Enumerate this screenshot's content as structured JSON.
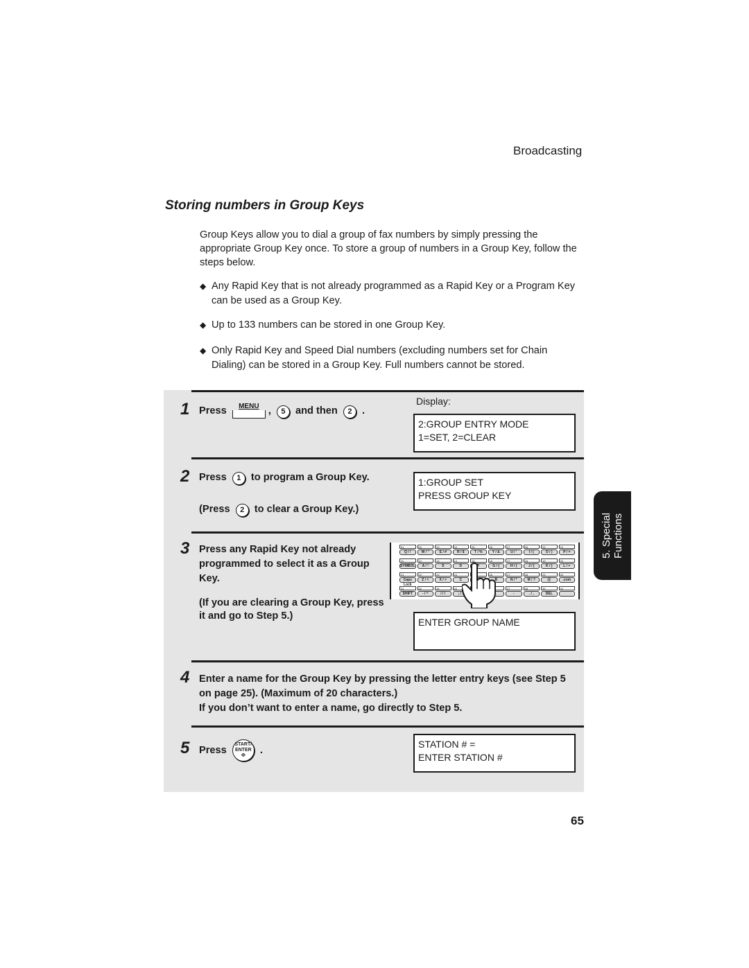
{
  "header": {
    "running_head": "Broadcasting"
  },
  "section": {
    "title": "Storing numbers in Group Keys"
  },
  "intro": "Group Keys allow you to dial a group of fax numbers by simply pressing the appropriate Group Key once. To store a group of numbers in a Group Key, follow the steps below.",
  "bullets": [
    {
      "icon": "diamond-bullet-icon",
      "text": "Any Rapid Key that is not already programmed as a Rapid Key or a Program Key can be used as a Group Key."
    },
    {
      "icon": "diamond-bullet-icon",
      "text": "Up to 133 numbers can be stored in one Group Key."
    },
    {
      "icon": "diamond-bullet-icon",
      "text": "Only Rapid Key and Speed Dial numbers (excluding numbers set for Chain Dialing) can be stored in a Group Key. Full numbers cannot be stored."
    }
  ],
  "steps": [
    {
      "number": "1",
      "press": "Press",
      "menu_key": "MENU",
      "comma": ",",
      "key_a": "5",
      "and_then": "and then",
      "key_b": "2",
      "period": ".",
      "display_label": "Display:",
      "display": [
        "2:GROUP ENTRY MODE",
        "1=SET, 2=CLEAR"
      ]
    },
    {
      "number": "2",
      "press": "Press",
      "key": "1",
      "text": "to program a Group Key.",
      "alt_open": "(Press",
      "alt_key": "2",
      "alt_text": "to clear a Group Key.)",
      "display": [
        "1:GROUP SET",
        "PRESS GROUP KEY"
      ]
    },
    {
      "number": "3",
      "text": "Press any Rapid Key not already programmed to select it as a Group Key.",
      "note": "(If you are clearing a Group Key, press it and go to Step 5.)",
      "display": [
        "ENTER GROUP NAME",
        ""
      ]
    },
    {
      "number": "4",
      "text": "Enter a name for the Group Key by pressing the letter entry keys (see Step 5 on page 25). (Maximum of 20 characters.)",
      "text2": "If you don’t want to enter a name, go directly to Step 5."
    },
    {
      "number": "5",
      "press": "Press",
      "start_key": [
        "START/",
        "ENTER",
        "Φ"
      ],
      "period": ".",
      "display": [
        "STATION # =",
        "ENTER STATION #"
      ]
    }
  ],
  "keyboard": {
    "rows": [
      {
        "nums": [
          "01",
          "02",
          "03",
          "04",
          "05",
          "06",
          "07",
          "08",
          "09",
          "10"
        ],
        "keys": [
          "Q / !",
          "W / \"",
          "E / #",
          "R / $",
          "T / %",
          "Y / &",
          "U / '",
          "I / (",
          "O / )",
          "P / ="
        ]
      },
      {
        "nums": [
          "11",
          "12",
          "13",
          "14",
          "15",
          "16",
          "17",
          "18",
          "19",
          "20"
        ],
        "keys": [
          "SYMBOL",
          "A / !",
          "S",
          "D",
          "F",
          "G / {",
          "H / }",
          "J / [",
          "K / ]",
          "L / +"
        ]
      },
      {
        "nums": [
          "21",
          "22",
          "23",
          "24",
          "25",
          "26",
          "27",
          "28",
          "29",
          "30"
        ],
        "keys": [
          "Caps Lock",
          "Z / <",
          "X / >",
          "C",
          "V",
          "B",
          "N / *",
          "M / ?",
          "@",
          ".com"
        ]
      },
      {
        "nums": [
          "31",
          "32",
          "33",
          "34",
          "35",
          "36",
          "37",
          "38",
          "39",
          "40"
        ],
        "keys": [
          "SHIFT",
          "- / ^",
          "/ / \\",
          "; / :",
          "",
          "_",
          "-",
          ". / ,",
          "DEL",
          ""
        ]
      }
    ]
  },
  "side_tab": {
    "line1": "5. Special",
    "line2": "Functions"
  },
  "footer": {
    "page_number": "65"
  }
}
